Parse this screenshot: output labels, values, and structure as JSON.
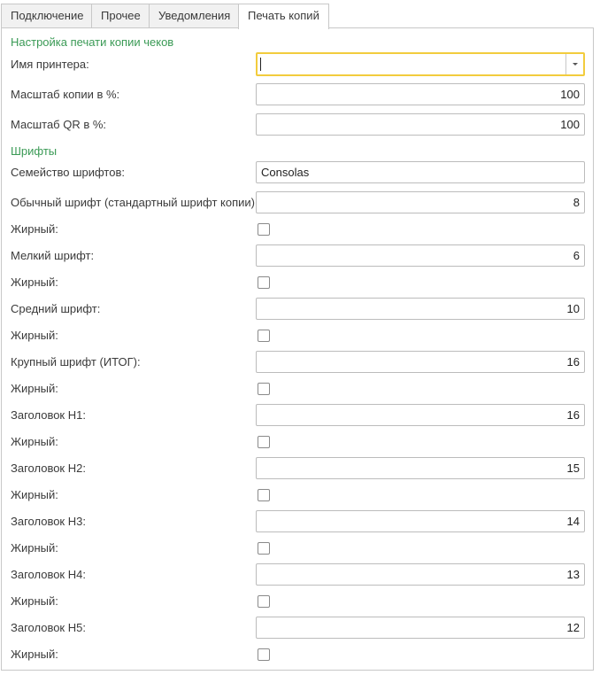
{
  "tabs": [
    "Подключение",
    "Прочее",
    "Уведомления",
    "Печать копий"
  ],
  "active_tab": 3,
  "sections": {
    "print_copy_title": "Настройка печати копии чеков",
    "fonts_title": "Шрифты"
  },
  "printer": {
    "label": "Имя принтера:",
    "value": ""
  },
  "copy_scale": {
    "label": "Масштаб копии в %:",
    "value": "100"
  },
  "qr_scale": {
    "label": "Масштаб QR в %:",
    "value": "100"
  },
  "font_family": {
    "label": "Семейство шрифтов:",
    "value": "Consolas"
  },
  "fonts": [
    {
      "label": "Обычный шрифт (стандартный шрифт копии):",
      "value": "8",
      "bold_label": "Жирный:",
      "bold": false
    },
    {
      "label": "Мелкий шрифт:",
      "value": "6",
      "bold_label": "Жирный:",
      "bold": false
    },
    {
      "label": "Средний шрифт:",
      "value": "10",
      "bold_label": "Жирный:",
      "bold": false
    },
    {
      "label": "Крупный шрифт (ИТОГ):",
      "value": "16",
      "bold_label": "Жирный:",
      "bold": false
    },
    {
      "label": "Заголовок H1:",
      "value": "16",
      "bold_label": "Жирный:",
      "bold": false
    },
    {
      "label": "Заголовок H2:",
      "value": "15",
      "bold_label": "Жирный:",
      "bold": false
    },
    {
      "label": "Заголовок H3:",
      "value": "14",
      "bold_label": "Жирный:",
      "bold": false
    },
    {
      "label": "Заголовок H4:",
      "value": "13",
      "bold_label": "Жирный:",
      "bold": false
    },
    {
      "label": "Заголовок H5:",
      "value": "12",
      "bold_label": "Жирный:",
      "bold": false
    }
  ],
  "colors": {
    "section_title": "#3a9a55",
    "focus_border": "#f2cc3d"
  }
}
